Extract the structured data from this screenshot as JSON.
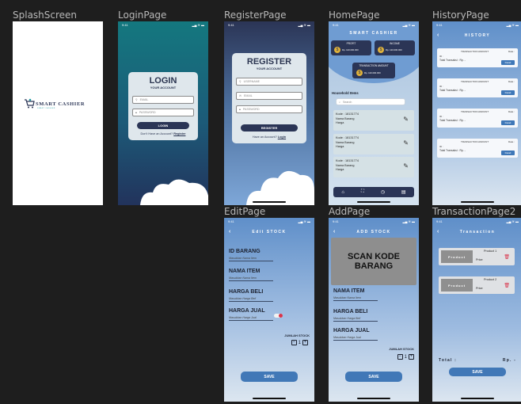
{
  "frames": {
    "splash": "SplashScreen",
    "login": "LoginPage",
    "register": "RegisterPage",
    "home": "HomePage",
    "history": "HistoryPage",
    "edit": "EditPage",
    "add": "AddPage",
    "transaction": "TransactionPage2"
  },
  "status": {
    "time": "9:41",
    "icons": "▂▄ ≋ ▬"
  },
  "splash": {
    "logo_main": "SMART CASHIER",
    "logo_sub": "SMART CASHIER"
  },
  "login": {
    "title": "LOGIN",
    "subtitle": "YOUR ACCOUNT",
    "email_ph": "EMAIL",
    "password_ph": "PASSWORD",
    "button": "LOGIN",
    "footer_q": "Don't Have an Account?",
    "footer_link": "Register"
  },
  "register": {
    "title": "REGISTER",
    "subtitle": "YOUR ACCOUNT",
    "username_ph": "USERNAME",
    "email_ph": "EMAIL",
    "password_ph": "PASSWORD",
    "button": "REGISTER",
    "footer_q": "Have an Account?",
    "footer_link": "Login"
  },
  "home": {
    "title": "SMART CASHIER",
    "profit_label": "PROFIT",
    "profit_value": "Rp. 120.000.000",
    "income_label": "INCOME",
    "income_value": "Rp. 120.000.000",
    "trx_label": "TRANSACTION AMOUNT",
    "trx_value": "Rp. 120.000.000",
    "section": "Household Items",
    "search_ph": "Search",
    "items": [
      {
        "kode": "Kode : 18131774",
        "nama": "Nama Barang",
        "harga": "Harga"
      },
      {
        "kode": "Kode : 18131774",
        "nama": "Nama Barang",
        "harga": "Harga"
      },
      {
        "kode": "Kode : 18131774",
        "nama": "Nama Barang",
        "harga": "Harga"
      }
    ]
  },
  "history": {
    "title": "HISTORY",
    "cards": [
      {
        "head": "TRANSACTION AMOUNT",
        "date": "Date :",
        "id": "ID :",
        "total": "Total Transaksi : Rp. -",
        "btn": "Detail"
      },
      {
        "head": "TRANSACTION AMOUNT",
        "date": "Date :",
        "id": "ID :",
        "total": "Total Transaksi : Rp. -",
        "btn": "Detail"
      },
      {
        "head": "TRANSACTION AMOUNT",
        "date": "Date :",
        "id": "ID :",
        "total": "Total Transaksi : Rp. -",
        "btn": "Detail"
      },
      {
        "head": "TRANSACTION AMOUNT",
        "date": "Date :",
        "id": "ID :",
        "total": "Total Transaksi : Rp. -",
        "btn": "Detail"
      }
    ]
  },
  "edit": {
    "title": "Edit STOCK",
    "id_label": "ID BARANG",
    "id_ph": "Masukkan Nama Item",
    "nama_label": "NAMA ITEM",
    "nama_ph": "Masukkan Nama Item",
    "beli_label": "HARGA BELI",
    "beli_ph": "Masukkan Harga Beli",
    "jual_label": "HARGA JUAL",
    "jual_ph": "Masukkan Harga Jual",
    "stock_label": "JUMLAH STOCK",
    "minus": "−",
    "qty": "1",
    "plus": "+",
    "save": "SAVE"
  },
  "add": {
    "title": "ADD STOCK",
    "scan": "SCAN KODE BARANG",
    "nama_label": "NAMA ITEM",
    "nama_ph": "Masukkan Nama Item",
    "beli_label": "HARGA BELI",
    "beli_ph": "Masukkan Harga Beli",
    "jual_label": "HARGA JUAL",
    "jual_ph": "Masukkan Harga Jual",
    "stock_label": "JUMLAH STOCK",
    "minus": "−",
    "qty": "1",
    "plus": "+",
    "save": "SAVE"
  },
  "transaction": {
    "title": "Transaction",
    "items": [
      {
        "thumb": "Product",
        "name": "Product 1",
        "price": "Price"
      },
      {
        "thumb": "Product",
        "name": "Product 2",
        "price": "Price"
      }
    ],
    "total_label": "Total :",
    "total_value": "Rp. -",
    "save": "SAVE"
  },
  "colors": {
    "navy": "#2b3556",
    "teal": "#1f7f86",
    "sky": "#6f9cd2",
    "accent": "#3f78b8"
  }
}
